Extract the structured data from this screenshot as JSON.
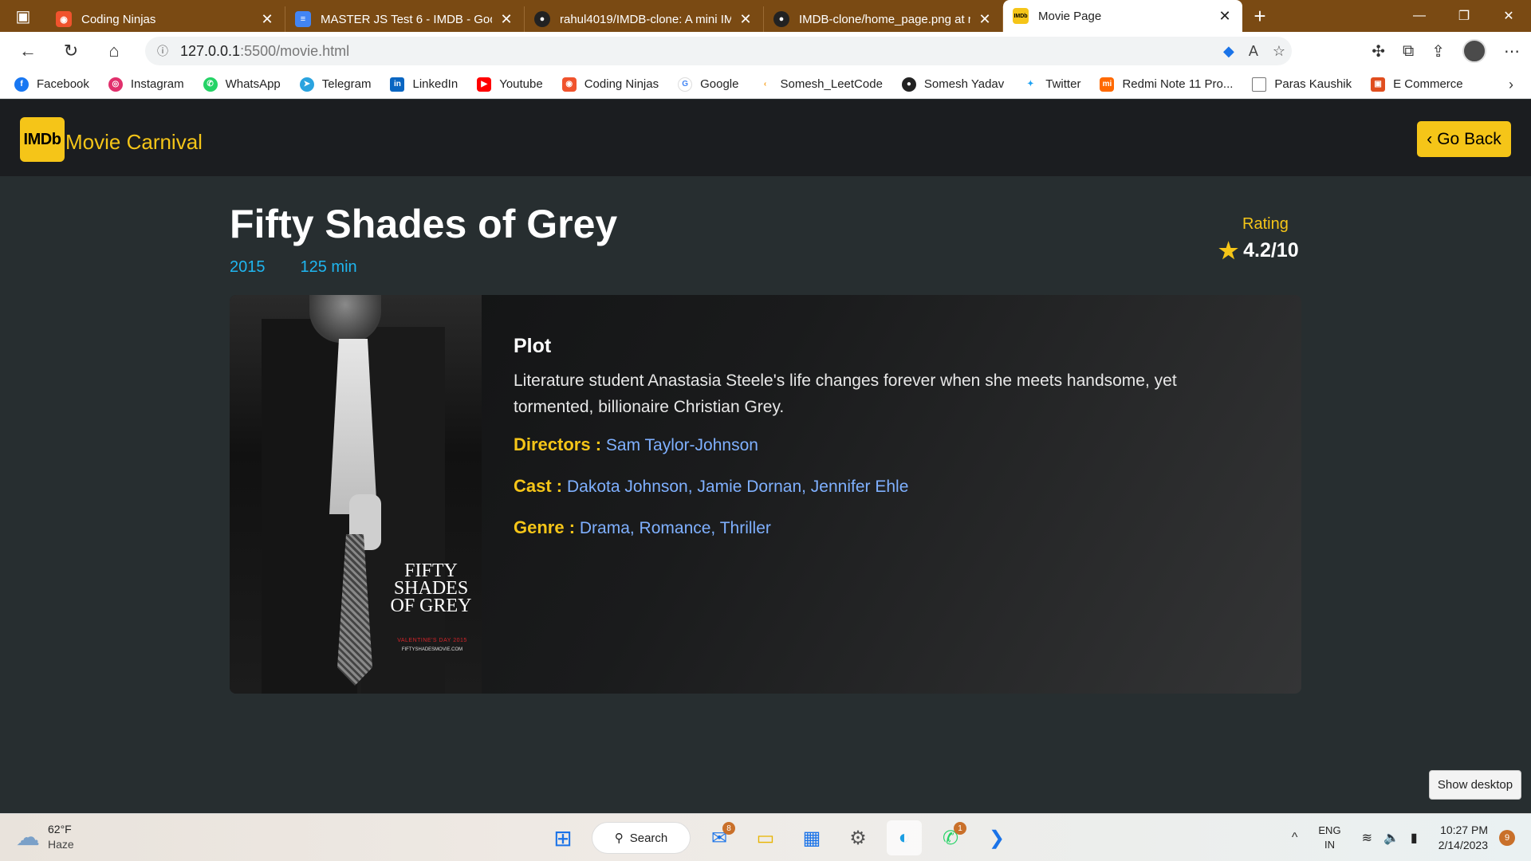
{
  "browser": {
    "tabs": [
      {
        "title": "Coding Ninjas",
        "icon": "coding-ninjas-icon",
        "color": "#f0532d"
      },
      {
        "title": "MASTER JS Test 6 - IMDB - Goog",
        "icon": "google-docs-icon",
        "color": "#4285f4"
      },
      {
        "title": "rahul4019/IMDB-clone: A mini IM",
        "icon": "github-icon",
        "color": "#222222"
      },
      {
        "title": "IMDB-clone/home_page.png at r",
        "icon": "github-icon",
        "color": "#222222"
      },
      {
        "title": "Movie Page",
        "icon": "imdb-icon",
        "color": "#f5c518"
      }
    ],
    "url_host": "127.0.0.1",
    "url_path": ":5500/movie.html"
  },
  "bookmarks": [
    {
      "label": "Facebook",
      "color": "#1877f2"
    },
    {
      "label": "Instagram",
      "color": "#e1306c"
    },
    {
      "label": "WhatsApp",
      "color": "#25d366"
    },
    {
      "label": "Telegram",
      "color": "#2aa3df"
    },
    {
      "label": "LinkedIn",
      "color": "#0a66c2"
    },
    {
      "label": "Youtube",
      "color": "#ff0000"
    },
    {
      "label": "Coding Ninjas",
      "color": "#f0532d"
    },
    {
      "label": "Google",
      "color": "#4285f4"
    },
    {
      "label": "Somesh_LeetCode",
      "color": "#f89f1b"
    },
    {
      "label": "Somesh Yadav",
      "color": "#222222"
    },
    {
      "label": "Twitter",
      "color": "#1da1f2"
    },
    {
      "label": "Redmi Note 11 Pro...",
      "color": "#ff6900"
    },
    {
      "label": "Paras Kaushik",
      "color": "#777777"
    },
    {
      "label": "E Commerce",
      "color": "#e04e1f"
    }
  ],
  "navbar": {
    "logo_text": "IMDb",
    "brand": "Movie Carnival",
    "go_back": "Go Back"
  },
  "movie": {
    "title": "Fifty Shades of Grey",
    "year": "2015",
    "runtime": "125 min",
    "rating_label": "Rating",
    "rating": "4.2/10",
    "plot_heading": "Plot",
    "plot": "Literature student Anastasia Steele's life changes forever when she meets handsome, yet tormented, billionaire Christian Grey.",
    "directors_label": "Directors :",
    "directors": "Sam Taylor-Johnson",
    "cast_label": "Cast :",
    "cast": "Dakota Johnson, Jamie Dornan, Jennifer Ehle",
    "genre_label": "Genre :",
    "genre": "Drama, Romance, Thriller",
    "poster_title": "FIFTY SHADES OF GREY",
    "poster_date": "VALENTINE'S DAY 2015",
    "poster_site": "FIFTYSHADESMOVIE.COM"
  },
  "show_desktop": "Show desktop",
  "taskbar": {
    "temperature": "62°F",
    "weather": "Haze",
    "search": "Search",
    "mail_badge": "8",
    "whatsapp_badge": "1",
    "lang_1": "ENG",
    "lang_2": "IN",
    "time": "10:27 PM",
    "date": "2/14/2023",
    "notifications": "9"
  }
}
